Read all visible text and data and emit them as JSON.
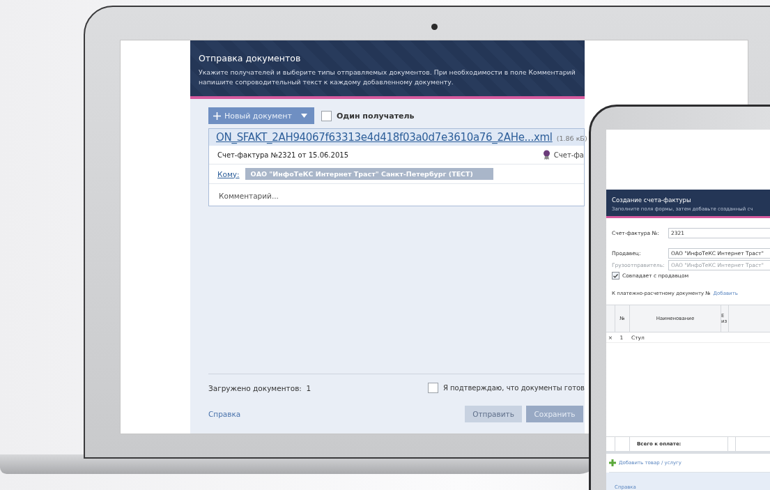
{
  "laptop_screen": {
    "dialog": {
      "title": "Отправка документов",
      "description": "Укажите получателей и выберите типы отправляемых документов. При необходимости в поле Комментарий напишите сопроводительный текст к каждому добавленному документу.",
      "new_document_button": "Новый документ",
      "single_recipient": {
        "label": "Один получатель",
        "checked": false
      },
      "document": {
        "file_name": "ON_SFAKT_2AH94067f63313e4d418f03a0d7e3610a76_2AHe...xml",
        "file_size": "(1.86 кБ)",
        "invoice_title": "Счет-фактура №2321 от 15.06.2015",
        "document_type": "Счет-фа",
        "recipient_label": "Кому:",
        "recipient": "ОАО \"ИнфоТеКС Интернет Траст\" Санкт-Петербург (ТЕСТ)",
        "comment_placeholder": "Комментарий..."
      },
      "uploaded_label": "Загружено документов:",
      "uploaded_count": "1",
      "confirm": {
        "label": "Я подтверждаю, что документы готов",
        "checked": false
      },
      "help_link": "Справка",
      "buttons": [
        {
          "label": "Отправить",
          "disabled": true
        },
        {
          "label": "Сохранить",
          "disabled": false
        }
      ]
    }
  },
  "tablet_screen": {
    "form": {
      "title": "Создание счета-фактуры",
      "description": "Заполните поля формы, затем добавьте созданный сч",
      "invoice_number_label": "Счет-фактура №:",
      "invoice_number": "2321",
      "seller_label": "Продавец:",
      "seller": "ОАО \"ИнфоТеКС Интернет Траст\"",
      "shipper_label": "Грузоотправитель:",
      "shipper": "ОАО \"ИнфоТеКС Интернет Траст\"",
      "same_as_seller": {
        "label": "Совпадает с продавцом",
        "checked": true
      },
      "payment_doc_label": "К платежно-расчетному документу №",
      "add_link": "Добавить",
      "table": {
        "columns": [
          "№",
          "Наименование",
          "Е из"
        ],
        "rows": [
          {
            "delete": "×",
            "cells": [
              "1",
              "Стул"
            ]
          }
        ],
        "total_label": "Всего к оплате:"
      },
      "add_item_link": "Добавить товар / услугу",
      "help_link": "Справка"
    }
  }
}
